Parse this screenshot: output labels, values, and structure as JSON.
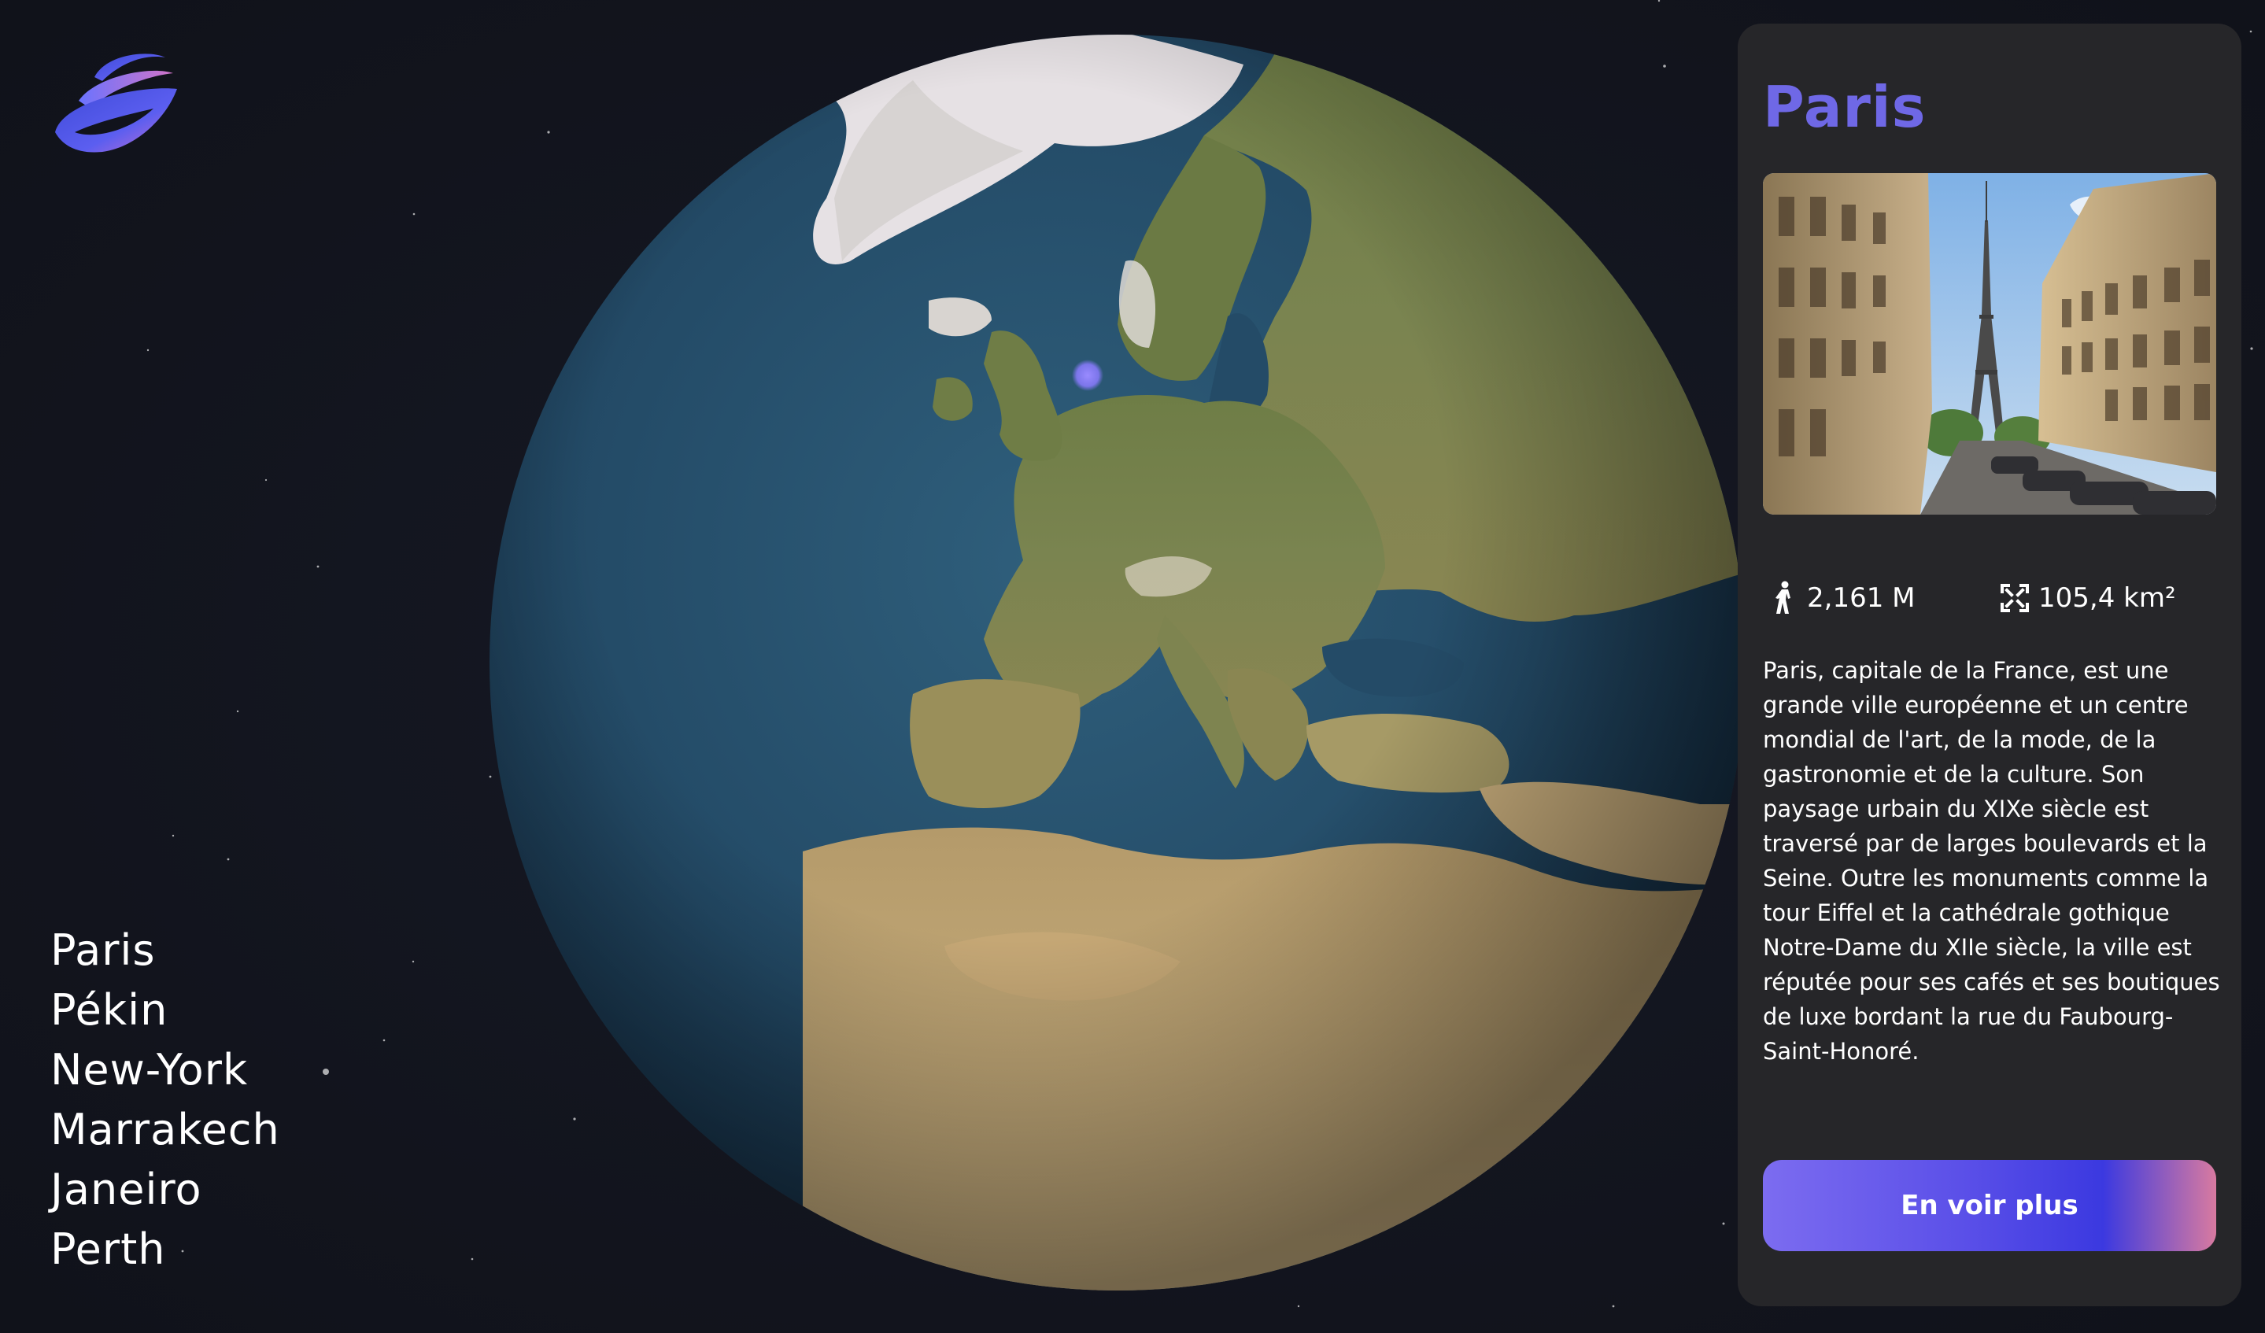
{
  "cities": [
    "Paris",
    "Pékin",
    "New-York",
    "Marrakech",
    "Janeiro",
    "Perth"
  ],
  "panel": {
    "title": "Paris",
    "population": "2,161 M",
    "area": "105,4 km²",
    "description": "Paris, capitale de la France, est une grande ville européenne et un centre mondial de l'art, de la mode, de la gastronomie et de la culture. Son paysage urbain du XIXe siècle est traversé par de larges boulevards et la Seine. Outre les monuments comme la tour Eiffel et la cathédrale gothique Notre-Dame du XIIe siècle, la ville est réputée pour ses cafés et ses boutiques de luxe bordant la rue du Faubourg-Saint-Honoré.",
    "button_label": "En voir plus"
  },
  "icons": {
    "logo": "planet-logo-icon",
    "population": "person-walking-icon",
    "area": "expand-icon"
  },
  "colors": {
    "accent": "#6f68e6",
    "marker": "#8a7bff",
    "panel_bg": "#262629",
    "page_bg": "#13151f"
  }
}
